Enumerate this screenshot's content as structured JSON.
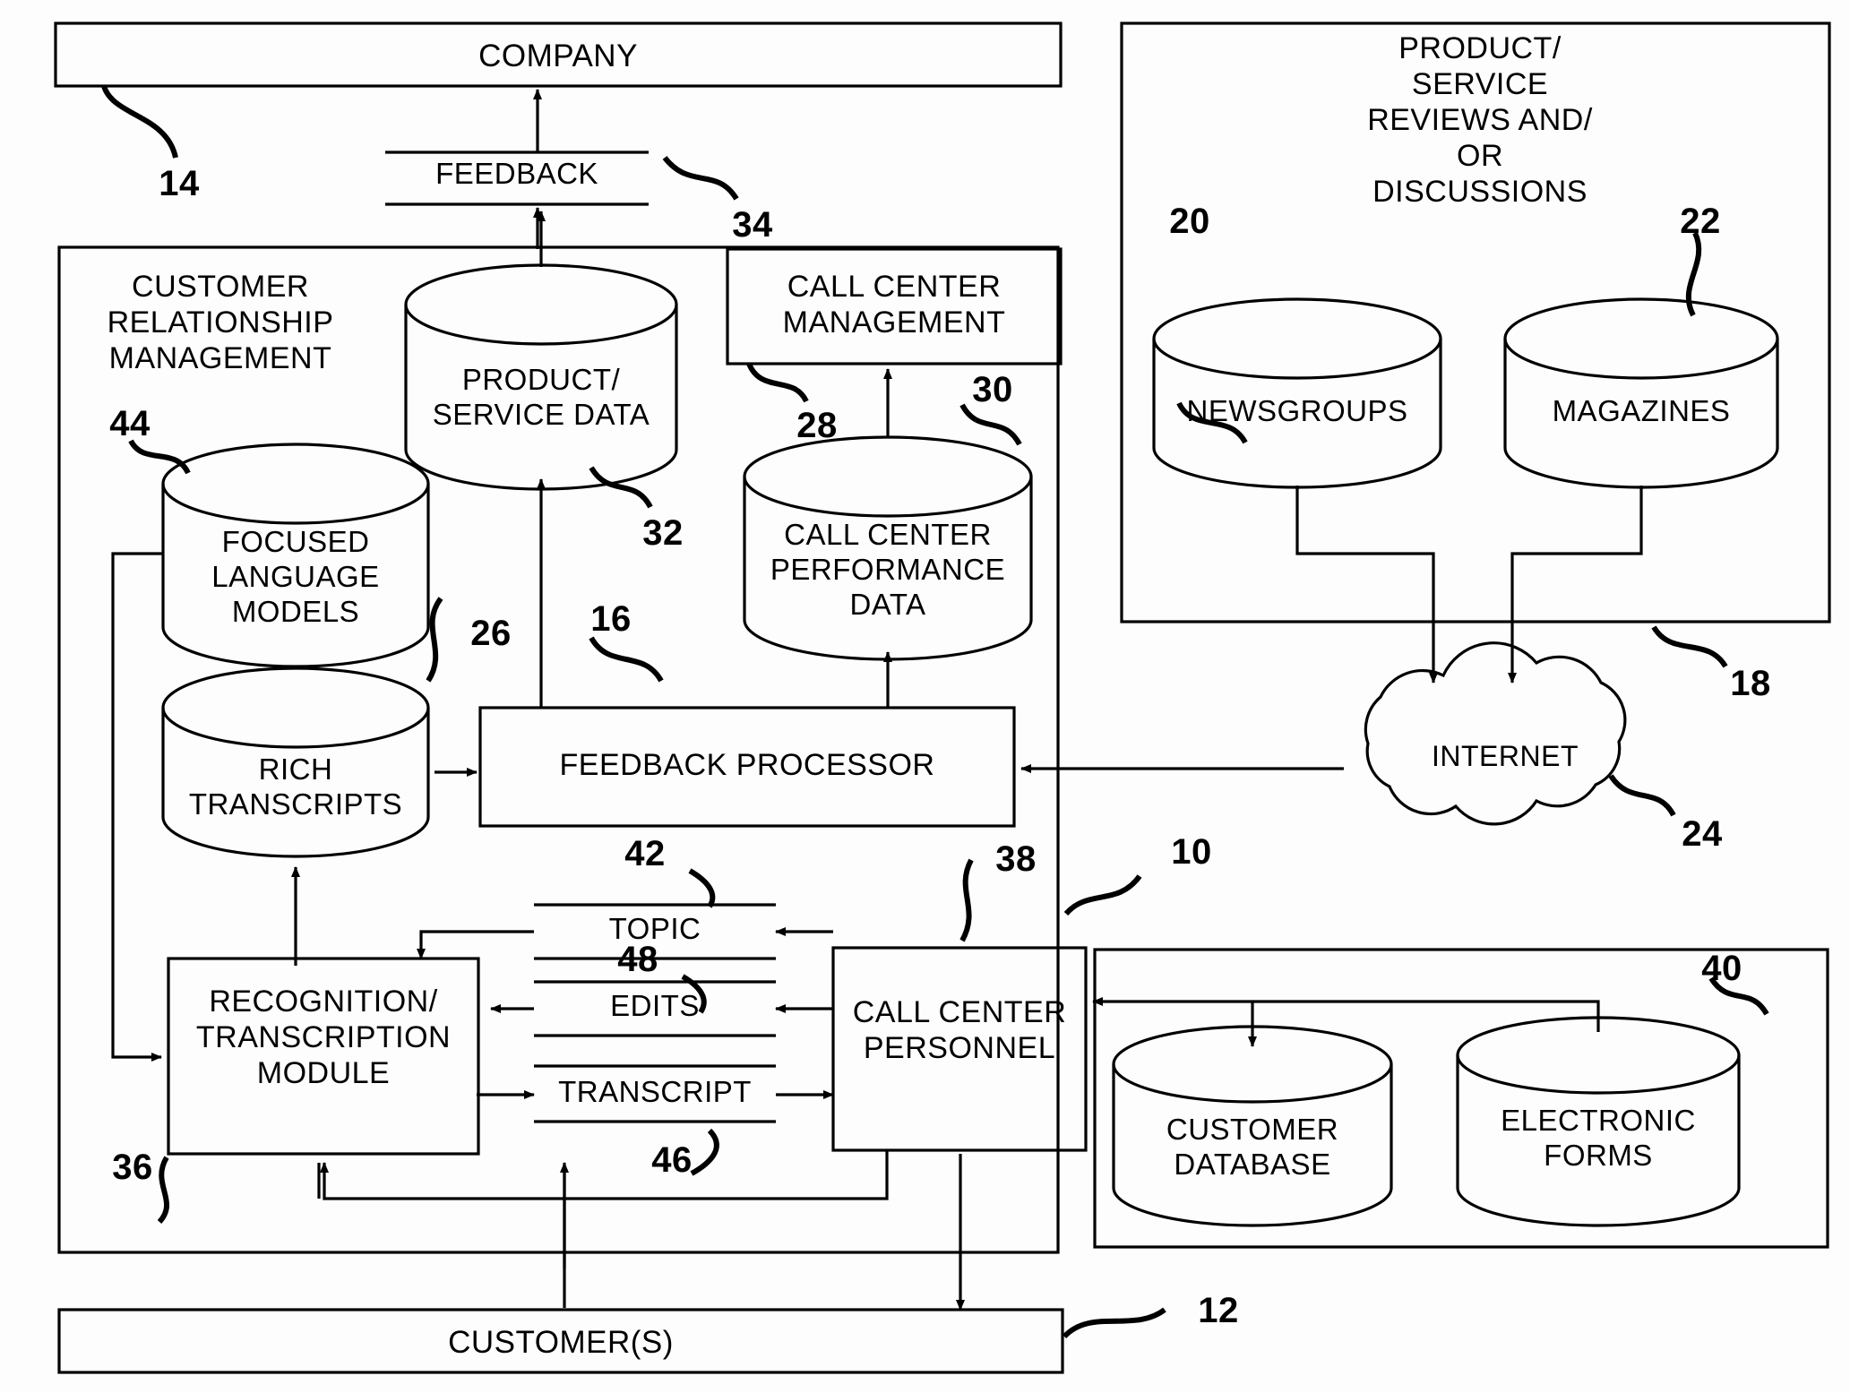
{
  "figure": {
    "type": "patent-block-diagram",
    "title": "Customer feedback processing system block diagram"
  },
  "boxes": {
    "company": {
      "label": "COMPANY",
      "ref": "14"
    },
    "feedback_flow": {
      "label": "FEEDBACK",
      "ref": "34"
    },
    "crm": {
      "label": "CUSTOMER\nRELATIONSHIP\nMANAGEMENT",
      "ref": "44"
    },
    "call_center_management": {
      "label": "CALL CENTER\nMANAGEMENT",
      "ref": "28"
    },
    "feedback_processor": {
      "label": "FEEDBACK PROCESSOR",
      "ref": "16"
    },
    "recognition_module": {
      "label": "RECOGNITION/\nTRANSCRIPTION\nMODULE",
      "ref": "36"
    },
    "call_center_personnel": {
      "label": "CALL CENTER\nPERSONNEL",
      "ref": "38"
    },
    "customers": {
      "label": "CUSTOMER(S)",
      "ref": "12"
    },
    "reviews": {
      "label": "PRODUCT/\nSERVICE\nREVIEWS AND/\nOR\nDISCUSSIONS",
      "ref": "18"
    },
    "system": {
      "ref": "10"
    },
    "right_lower_panel": {
      "ref": "40"
    }
  },
  "cylinders": {
    "product_service_data": {
      "label": "PRODUCT/\nSERVICE DATA",
      "ref": "32"
    },
    "call_center_performance_data": {
      "label": "CALL CENTER\nPERFORMANCE\nDATA",
      "ref": "30"
    },
    "focused_language_models": {
      "label": "FOCUSED\nLANGUAGE\nMODELS",
      "ref": "44"
    },
    "rich_transcripts": {
      "label": "RICH\nTRANSCRIPTS",
      "ref": "26"
    },
    "newsgroups": {
      "label": "NEWSGROUPS",
      "ref": "20"
    },
    "magazines": {
      "label": "MAGAZINES",
      "ref": "22"
    },
    "customer_database": {
      "label": "CUSTOMER\nDATABASE",
      "ref": ""
    },
    "electronic_forms": {
      "label": "ELECTRONIC\nFORMS",
      "ref": "40"
    }
  },
  "cloud": {
    "label": "INTERNET",
    "ref": "24"
  },
  "flow_labels": {
    "topic": {
      "label": "TOPIC",
      "ref": "42"
    },
    "edits": {
      "label": "EDITS",
      "ref": "48"
    },
    "transcript": {
      "label": "TRANSCRIPT",
      "ref": "46"
    }
  },
  "reference_numerals": {
    "n10": "10",
    "n12": "12",
    "n14": "14",
    "n16": "16",
    "n18": "18",
    "n20": "20",
    "n22": "22",
    "n24": "24",
    "n26": "26",
    "n28": "28",
    "n30": "30",
    "n32": "32",
    "n34": "34",
    "n36": "36",
    "n38": "38",
    "n40": "40",
    "n42": "42",
    "n44": "44",
    "n46": "46",
    "n48": "48"
  },
  "colors": {
    "line": "#000000",
    "background": "#ffffff"
  }
}
